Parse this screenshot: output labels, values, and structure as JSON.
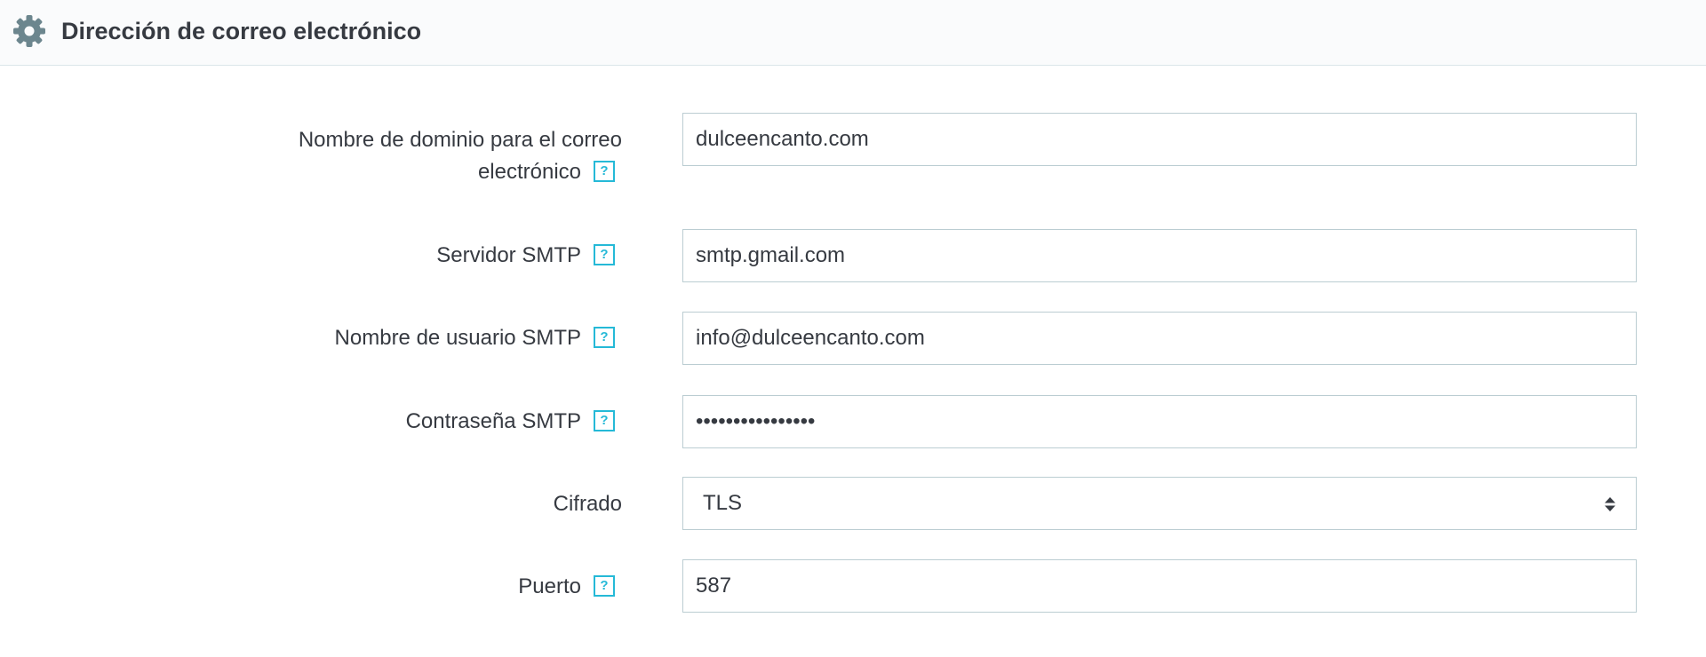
{
  "panel": {
    "title": "Dirección de correo electrónico",
    "icon": "gear-icon"
  },
  "fields": {
    "domain": {
      "label_line1": "Nombre de dominio para el correo",
      "label_line2": "electrónico",
      "value": "dulceencanto.com",
      "help": "?"
    },
    "smtp_server": {
      "label": "Servidor SMTP",
      "value": "smtp.gmail.com",
      "help": "?"
    },
    "smtp_user": {
      "label": "Nombre de usuario SMTP",
      "value": "info@dulceencanto.com",
      "help": "?"
    },
    "smtp_password": {
      "label": "Contraseña SMTP",
      "value": "••••••••••••••••",
      "help": "?"
    },
    "encryption": {
      "label": "Cifrado",
      "value": "TLS"
    },
    "port": {
      "label": "Puerto",
      "value": "587",
      "help": "?"
    }
  },
  "colors": {
    "accent": "#25b9d7",
    "border": "#bbcdd2",
    "header_bg": "#fafbfc",
    "text": "#363a41"
  }
}
